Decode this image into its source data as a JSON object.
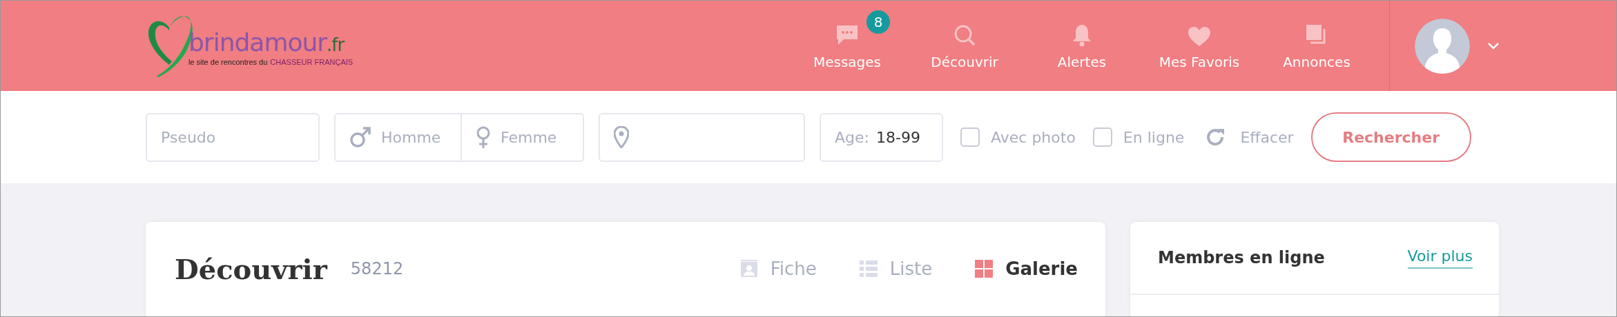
{
  "logo": {
    "name": "brindamour",
    "tld": ".fr",
    "tagline": "le site de rencontres du",
    "tagline_brand": "CHASSEUR FRANÇAIS"
  },
  "nav": [
    {
      "kind": "messages",
      "label": "Messages",
      "badge": "8"
    },
    {
      "kind": "search",
      "label": "Découvrir"
    },
    {
      "kind": "bell",
      "label": "Alertes"
    },
    {
      "kind": "heart",
      "label": "Mes Favoris"
    },
    {
      "kind": "copies",
      "label": "Annonces"
    }
  ],
  "search": {
    "pseudo": {
      "placeholder": "Pseudo"
    },
    "genders": [
      {
        "kind": "male",
        "label": "Homme",
        "selected": false
      },
      {
        "kind": "female",
        "label": "Femme",
        "selected": false
      }
    ],
    "age": {
      "label": "Age:",
      "value": "18-99"
    },
    "checkboxes": [
      {
        "label": "Avec photo",
        "checked": false
      },
      {
        "label": "En ligne",
        "checked": false
      }
    ],
    "reset": "Effacer",
    "submit": "Rechercher"
  },
  "main": {
    "title": "Découvrir",
    "count": "58212",
    "views": [
      {
        "kind": "card",
        "label": "Fiche",
        "selected": false
      },
      {
        "kind": "list",
        "label": "Liste",
        "selected": false
      },
      {
        "kind": "grid",
        "label": "Galerie",
        "selected": true
      }
    ]
  },
  "sidebar": {
    "title": "Membres en ligne",
    "link": "Voir plus"
  }
}
